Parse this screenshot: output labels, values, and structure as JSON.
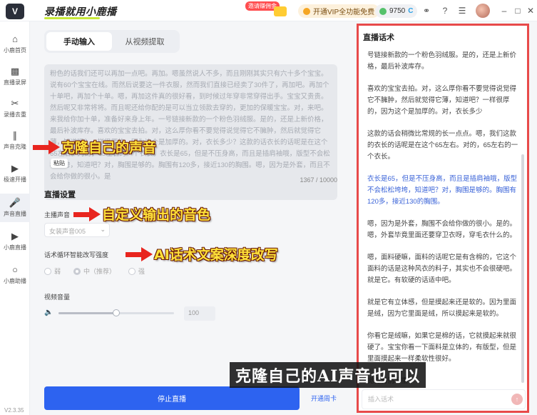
{
  "app": {
    "brand": "录播就用小鹿播",
    "invite_badge": "邀请赚佣金",
    "vip_button": "开通VIP全功能免费",
    "coins": "9750",
    "coin_suffix": "C",
    "version": "V2.3.35"
  },
  "sidebar": {
    "items": [
      {
        "label": "小鹿首页",
        "icon": "home-icon"
      },
      {
        "label": "直播录屏",
        "icon": "video-icon"
      },
      {
        "label": "录播去重",
        "icon": "scissors-icon"
      },
      {
        "label": "声音克隆",
        "icon": "waveform-icon"
      },
      {
        "label": "极速开播",
        "icon": "play-icon"
      },
      {
        "label": "声音直播",
        "icon": "microphone-icon"
      },
      {
        "label": "小鹿直播",
        "icon": "play-circle-icon"
      },
      {
        "label": "小鹿助播",
        "icon": "bulb-icon"
      }
    ],
    "active_index": 5
  },
  "main": {
    "tabs": [
      {
        "label": "手动输入",
        "active": true
      },
      {
        "label": "从视频提取",
        "active": false
      }
    ],
    "script_text": "粉色的话我们还可以再加一点吧。再加。嗯虽然说人不多，而且刚刚其实只有六十多个宝宝。说有60个宝宝在线。而然后说要这一件衣服，然而我们直接已经卖了30件了，再加吧。再加个十单吧，再加个十单。嗯，再加这件真的很好看，到时候过年穿非常穿得出手。宝宝又贵贵。然后呢又非常将将。而且呢还给你配的是可以当立领款去穿的，更加的保暖宝宝。对，来吧。来我给你加十单，准备好来身上年。一号链接新款的一个粉色羽绒服。是的，还是上新价格，最后补波库存。喜欢的宝宝去拍。对，这么厚你看不要觉得说觉得它不臃肿，然后就觉得它薄，知道吧？一样很厚的，因为这个是加厚的。对，衣长多少？这款的话衣长的话呢是在这个65左右。对的，65左右的一个衣长。衣长是65，但是不压身高，而且是插肩袖哦，版型不会松松垮垮，知道吧？对，胸围是够的。胸围有120多，接近130的胸围。嗯，因为是外套，而且不会给你做的很小。是",
    "paste_tag": "粘贴",
    "char_count": "1367 / 10000",
    "settings_title": "直播设置",
    "voice_label": "主播声音",
    "voice_value": "女装声音005",
    "rewrite_label": "话术循环智能改写强度",
    "rewrite_options": [
      {
        "label": "弱",
        "selected": false
      },
      {
        "label": "中（推荐）",
        "selected": true
      },
      {
        "label": "强",
        "selected": false
      }
    ],
    "volume_label": "视频音量",
    "volume_value": "100",
    "volume_level": 0.5,
    "stop_button": "停止直播",
    "weekly_link": "开通周卡"
  },
  "script_panel": {
    "title": "直播话术",
    "paragraphs": [
      {
        "text": "号链接新款的一个粉色羽绒服。是的，还是上新价格，最后补波库存。",
        "highlight": false
      },
      {
        "text": "喜欢的宝宝去拍。对，这么厚你看不要觉得说觉得它不臃肿，然后就觉得它薄，知道吧？一样很厚的，因为这个是加厚的。对，衣长多少",
        "highlight": false
      },
      {
        "text": "这款的话会稍微比常规的长一点点。嗯，我们这款的衣长的话呢是在这个65左右。对的，65左右的一个衣长。",
        "highlight": false
      },
      {
        "text": "衣长是65，但是不压身高，而且是插肩袖哦，版型不会松松垮垮，知道吧？对，胸围是够的。胸围有120多，接近130的胸围。",
        "highlight": true
      },
      {
        "text": "嗯，因为是外套，胸围不会给你做的很小。是的。嗯，外套毕竟里面还要穿卫衣呀，穿毛衣什么的。",
        "highlight": false
      },
      {
        "text": "嗯，面料硬嘛，面料的话呢它是有含棉的，它这个面料的话是这种风衣的料子，其实也不会很硬吧。就是它。有软硬的话适中吧。",
        "highlight": false
      },
      {
        "text": "就是它有立体感，但是摸起来还是软的。因为里面是绒，因为它里面是绒，所以摸起来是软的。",
        "highlight": false
      },
      {
        "text": "你看它是绒嘛，如果它是棉的话，它就摸起来就很硬了。宝宝你看一下面料是立体的，有版型，但是里面摸起来一样柔软性很好。",
        "highlight": false
      },
      {
        "text": "觉得特别笨重",
        "highlight": false
      }
    ],
    "input_placeholder": "插入话术"
  },
  "overlay": {
    "annotations": [
      "克隆自己的声音",
      "自定义输出的音色",
      "AI话术文案深度改写"
    ],
    "caption": "克隆自己的AI声音也可以"
  }
}
